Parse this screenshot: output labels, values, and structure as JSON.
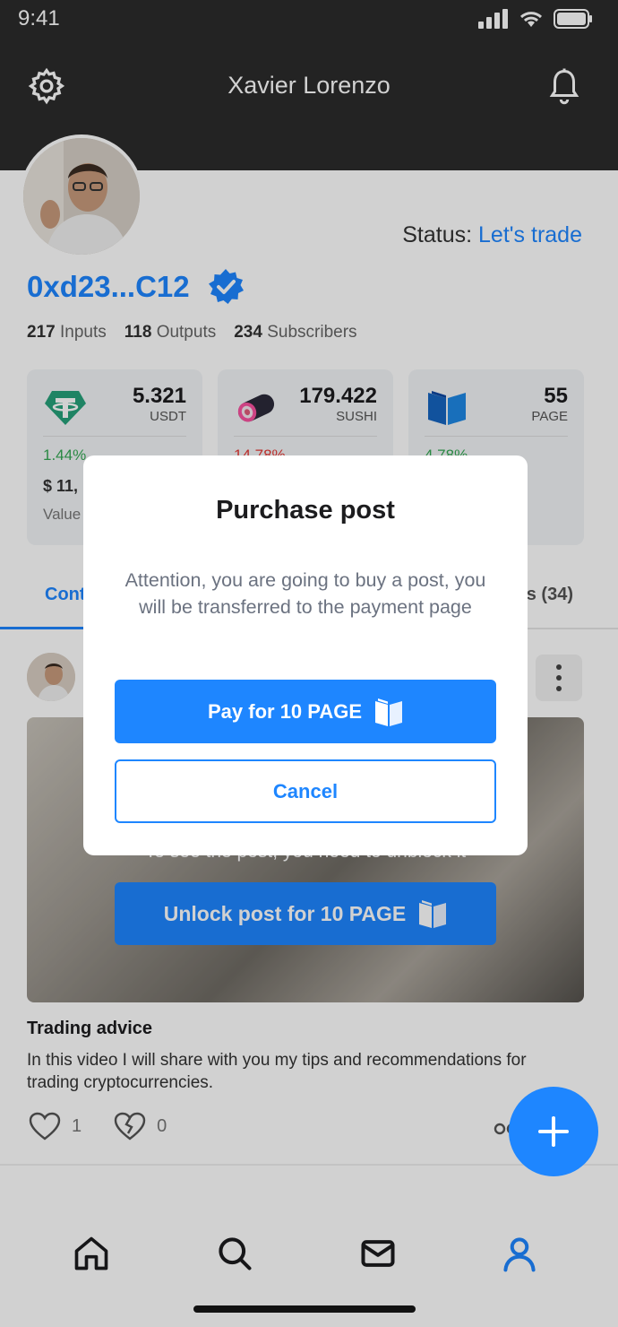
{
  "status_bar": {
    "time": "9:41"
  },
  "header": {
    "title": "Xavier Lorenzo"
  },
  "profile": {
    "status_label": "Status:",
    "status_value": "Let's trade",
    "wallet": "0xd23...C12",
    "stats": [
      {
        "count": "217",
        "label": "Inputs"
      },
      {
        "count": "118",
        "label": "Outputs"
      },
      {
        "count": "234",
        "label": "Subscribers"
      }
    ]
  },
  "tokens": [
    {
      "amount": "5.321",
      "code": "USDT",
      "change": "1.44%",
      "change_color": "#34a853",
      "usd": "$ 11,",
      "value_label": "Value",
      "icon": "tether-icon"
    },
    {
      "amount": "179.422",
      "code": "SUSHI",
      "change": "14.78%",
      "change_color": "#e53935",
      "icon": "sushi-icon"
    },
    {
      "amount": "55",
      "code": "PAGE",
      "change": "4.78%",
      "change_color": "#34a853",
      "icon": "page-book-icon"
    }
  ],
  "tabs": {
    "left": "Cont",
    "right": "s (34)"
  },
  "post": {
    "media_hint": "To see the post, you need to unblock it",
    "unlock_label": "Unlock post for 10 PAGE",
    "title": "Trading advice",
    "description": "In this video I will share with you my tips and recommendations for trading cryptocurrencies.",
    "likes": "1",
    "dislikes": "0"
  },
  "modal": {
    "title": "Purchase post",
    "body": "Attention, you are going to buy a post, you will be transferred to the payment page",
    "pay_label": "Pay for 10 PAGE",
    "cancel_label": "Cancel"
  },
  "colors": {
    "accent": "#1e86ff",
    "header_bg": "#2b2b2b"
  }
}
